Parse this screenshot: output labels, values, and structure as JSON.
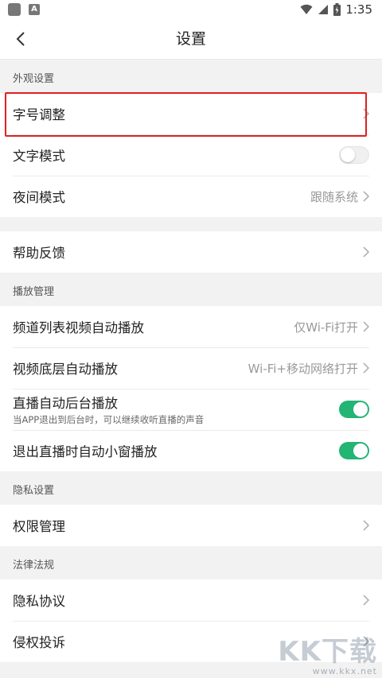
{
  "status_bar": {
    "time": "1:35"
  },
  "header": {
    "title": "设置"
  },
  "sections": {
    "appearance": {
      "label": "外观设置",
      "font_size": "字号调整",
      "text_mode": "文字模式",
      "night_mode": "夜间模式",
      "night_mode_value": "跟随系统"
    },
    "help": {
      "feedback": "帮助反馈"
    },
    "playback": {
      "label": "播放管理",
      "channel_autoplay": "频道列表视频自动播放",
      "channel_autoplay_value": "仅Wi-Fi打开",
      "bottom_autoplay": "视频底层自动播放",
      "bottom_autoplay_value": "Wi-Fi+移动网络打开",
      "live_background": "直播自动后台播放",
      "live_background_desc": "当APP退出到后台时，可以继续收听直播的声音",
      "live_small_window": "退出直播时自动小窗播放"
    },
    "privacy": {
      "label": "隐私设置",
      "permissions": "权限管理"
    },
    "legal": {
      "label": "法律法规",
      "privacy_policy": "隐私协议",
      "infringement": "侵权投诉"
    }
  },
  "toggles": {
    "text_mode": "off",
    "live_background": "on",
    "live_small_window": "on"
  },
  "colors": {
    "accent": "#22b573",
    "highlight": "#e02020"
  },
  "watermark": {
    "logo": "KK下载",
    "url": "www.kkx.net"
  }
}
